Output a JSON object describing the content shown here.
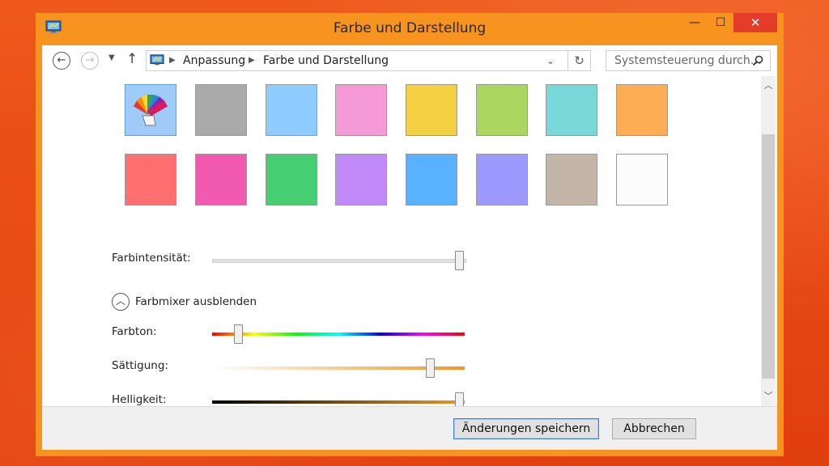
{
  "window": {
    "title": "Farbe und Darstellung",
    "controls": {
      "minimize": "—",
      "maximize": "☐",
      "close": "✕"
    }
  },
  "nav": {
    "back_icon": "arrow-left-icon",
    "forward_icon": "arrow-right-icon",
    "breadcrumb": [
      "Anpassung",
      "Farbe und Darstellung"
    ],
    "search_placeholder": "Systemsteuerung durch…"
  },
  "swatches": {
    "row1": [
      "#custom",
      "#aaaaaa",
      "#8ecbff",
      "#f59ad6",
      "#f3d143",
      "#aad760",
      "#79d9d9",
      "#ffad55"
    ],
    "row2": [
      "#ff6f6f",
      "#f25ab0",
      "#46cf72",
      "#c28af9",
      "#58b2ff",
      "#9c9aff",
      "#c3b5a7",
      "#fcfcfc"
    ]
  },
  "intensity": {
    "label": "Farbintensität:",
    "value": 1.0
  },
  "mixer": {
    "toggle_label": "Farbmixer ausblenden",
    "hue": {
      "label": "Farbton:",
      "value": 0.1
    },
    "saturation": {
      "label": "Sättigung:",
      "value": 0.84
    },
    "brightness": {
      "label": "Helligkeit:",
      "value": 1.0
    }
  },
  "buttons": {
    "save": "Änderungen speichern",
    "cancel": "Abbrechen"
  }
}
